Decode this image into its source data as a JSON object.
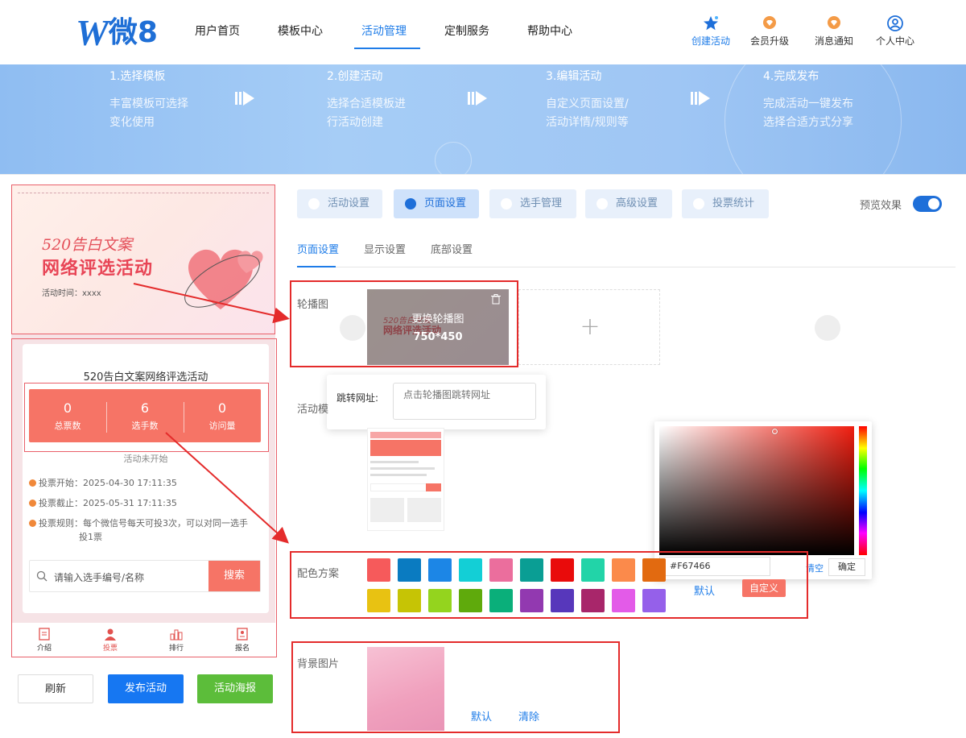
{
  "brand": {
    "logo_w": "W",
    "logo_text": "微8"
  },
  "nav": {
    "items": [
      {
        "label": "用户首页"
      },
      {
        "label": "模板中心"
      },
      {
        "label": "活动管理",
        "active": true
      },
      {
        "label": "定制服务"
      },
      {
        "label": "帮助中心"
      }
    ]
  },
  "tools": {
    "create": "创建活动",
    "upgrade": "会员升级",
    "notify": "消息通知",
    "profile": "个人中心"
  },
  "steps": [
    {
      "title": "1.选择模板",
      "desc1": "丰富模板可选择",
      "desc2": "变化使用"
    },
    {
      "title": "2.创建活动",
      "desc1": "选择合适模板进",
      "desc2": "行活动创建"
    },
    {
      "title": "3.编辑活动",
      "desc1": "自定义页面设置/",
      "desc2": "活动详情/规则等"
    },
    {
      "title": "4.完成发布",
      "desc1": "完成活动一键发布",
      "desc2": "选择合适方式分享"
    }
  ],
  "preview": {
    "banner_line1": "520告白文案",
    "banner_line2": "网络评选活动",
    "banner_time": "活动时间：xxxx",
    "card_title": "520告白文案网络评选活动",
    "stats": [
      {
        "value": "0",
        "label": "总票数"
      },
      {
        "value": "6",
        "label": "选手数"
      },
      {
        "value": "0",
        "label": "访问量"
      }
    ],
    "status": "活动未开始",
    "vote_start": "投票开始：2025-04-30 17:11:35",
    "vote_end": "投票截止：2025-05-31 17:11:35",
    "vote_rule_1": "投票规则：每个微信号每天可投3次，可以对同一选手",
    "vote_rule_2": "投1票",
    "search_placeholder": "请输入选手编号/名称",
    "search_button": "搜索",
    "tabbar": [
      {
        "label": "介绍"
      },
      {
        "label": "投票",
        "active": true
      },
      {
        "label": "排行"
      },
      {
        "label": "报名"
      }
    ]
  },
  "actions": {
    "refresh": "刷新",
    "publish": "发布活动",
    "poster": "活动海报"
  },
  "editor": {
    "tabs": [
      {
        "label": "活动设置"
      },
      {
        "label": "页面设置",
        "active": true
      },
      {
        "label": "选手管理"
      },
      {
        "label": "高级设置"
      },
      {
        "label": "投票统计"
      }
    ],
    "preview_effect": "预览效果",
    "preview_toggle_on": true,
    "subtabs": [
      {
        "label": "页面设置",
        "active": true
      },
      {
        "label": "显示设置"
      },
      {
        "label": "底部设置"
      }
    ],
    "carousel_label": "轮播图",
    "carousel_replace": "更换轮播图",
    "carousel_size": "750*450",
    "carousel_thumb_line1": "520告白文案",
    "carousel_thumb_line2": "网络评选活动",
    "carousel_add": "+",
    "jump_label": "跳转网址:",
    "jump_placeholder": "点击轮播图跳转网址",
    "template_label": "活动模",
    "color_label": "配色方案",
    "swatches_row1": [
      "#f65a5b",
      "#0a7bc1",
      "#1c86e6",
      "#13cfd6",
      "#eb6e9d",
      "#0a9e94",
      "#e90b0b",
      "#22d4a8",
      "#fb8a4b",
      "#e26a10"
    ],
    "swatches_row2": [
      "#e8c212",
      "#c6c405",
      "#94d41e",
      "#5faa0c",
      "#0aaf7a",
      "#9239b0",
      "#5737bb",
      "#a8266a",
      "#e35be8",
      "#9560ea"
    ],
    "color_default": "默认",
    "color_custom": "自定义",
    "picker_hex": "#F67466",
    "picker_clear": "清空",
    "picker_ok": "确定",
    "bg_label": "背景图片",
    "bg_default": "默认",
    "bg_clear": "清除"
  }
}
